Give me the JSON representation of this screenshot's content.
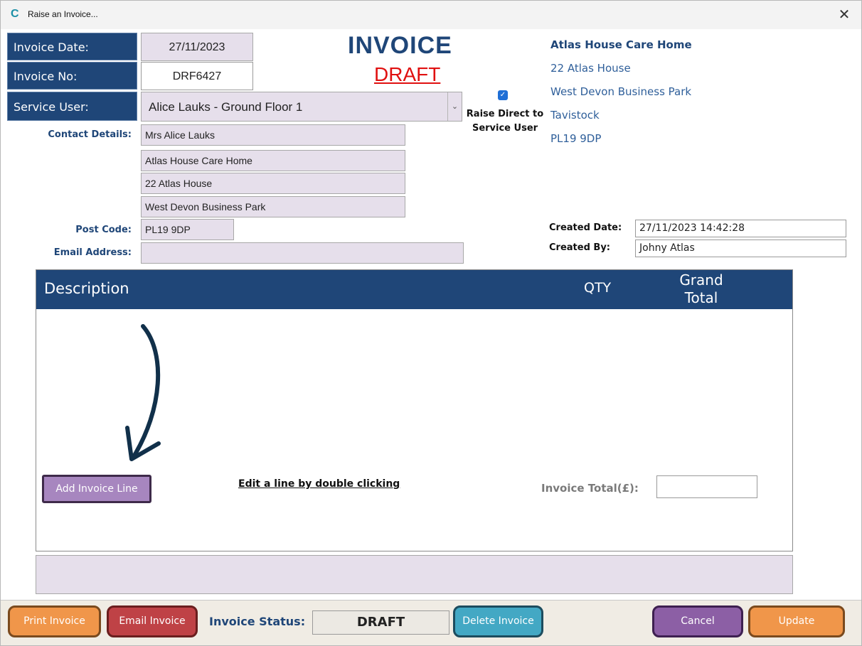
{
  "window": {
    "title": "Raise an Invoice...",
    "close_glyph": "✕",
    "app_icon_glyph": "C"
  },
  "fields": {
    "invoice_date_label": "Invoice Date:",
    "invoice_date_value": "27/11/2023",
    "invoice_no_label": "Invoice No:",
    "invoice_no_value": "DRF6427",
    "service_user_label": "Service User:",
    "service_user_value": "Alice Lauks - Ground Floor 1"
  },
  "heading": {
    "title": "INVOICE",
    "status_banner": "DRAFT"
  },
  "raise_direct": {
    "checked": true,
    "label": "Raise Direct to Service User"
  },
  "company_address": {
    "name": "Atlas House Care Home",
    "lines": [
      "22 Atlas House",
      "West Devon Business Park",
      "Tavistock",
      "PL19 9DP"
    ]
  },
  "contact": {
    "contact_details_label": "Contact Details:",
    "lines": [
      "Mrs Alice Lauks",
      "Atlas House Care Home",
      "22 Atlas House",
      "West Devon Business Park"
    ],
    "post_code_label": "Post Code:",
    "post_code_value": "PL19 9DP",
    "email_label": "Email Address:",
    "email_value": ""
  },
  "created": {
    "date_label": "Created Date:",
    "date_value": "27/11/2023 14:42:28",
    "by_label": "Created By:",
    "by_value": "Johny Atlas"
  },
  "lines_table": {
    "columns": {
      "description": "Description",
      "qty": "QTY",
      "grand_total_line1": "Grand",
      "grand_total_line2": "Total"
    },
    "rows": [],
    "add_line_label": "Add Invoice Line",
    "edit_hint": "Edit a line by double clicking",
    "total_label": "Invoice Total(£):",
    "total_value": ""
  },
  "toolbar": {
    "print_label": "Print Invoice",
    "email_label": "Email Invoice",
    "status_label": "Invoice Status:",
    "status_value": "DRAFT",
    "delete_label": "Delete Invoice",
    "cancel_label": "Cancel",
    "update_label": "Update"
  },
  "colors": {
    "navy": "#1f4678",
    "lavender": "#e6dfeb",
    "draft_red": "#e01010",
    "orange": "#f0964a",
    "red": "#bf4246",
    "teal": "#43a8c4",
    "purple": "#8c5fa5"
  }
}
